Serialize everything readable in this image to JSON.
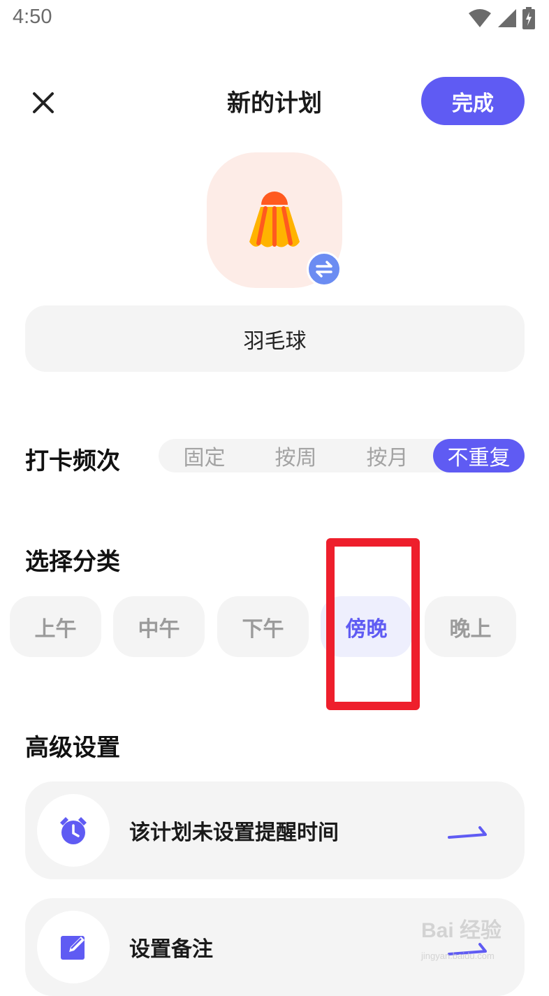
{
  "status_bar": {
    "time": "4:50",
    "icons": [
      "wifi-icon",
      "cellular-signal-icon",
      "battery-charging-icon"
    ]
  },
  "header": {
    "title": "新的计划",
    "done_label": "完成",
    "close_icon": "close-icon"
  },
  "plan": {
    "icon": "badminton-shuttlecock-icon",
    "swap_icon": "swap-arrows-icon",
    "name": "羽毛球"
  },
  "frequency": {
    "title": "打卡频次",
    "options": [
      "固定",
      "按周",
      "按月",
      "不重复"
    ],
    "selected": "不重复"
  },
  "category": {
    "title": "选择分类",
    "options": [
      "上午",
      "中午",
      "下午",
      "傍晚",
      "晚上"
    ],
    "selected": "傍晚"
  },
  "advanced": {
    "title": "高级设置",
    "items": [
      {
        "label": "该计划未设置提醒时间",
        "icon": "alarm-clock-icon"
      },
      {
        "label": "设置备注",
        "icon": "edit-note-icon"
      }
    ]
  },
  "colors": {
    "accent": "#5f5bf3",
    "highlight_box": "#ee1f2c",
    "chip_bg": "#f4f4f4",
    "icon_tile_bg": "#fdece7"
  },
  "watermark": {
    "text": "Bai 经验",
    "sub": "jingyan.baidu.com"
  }
}
